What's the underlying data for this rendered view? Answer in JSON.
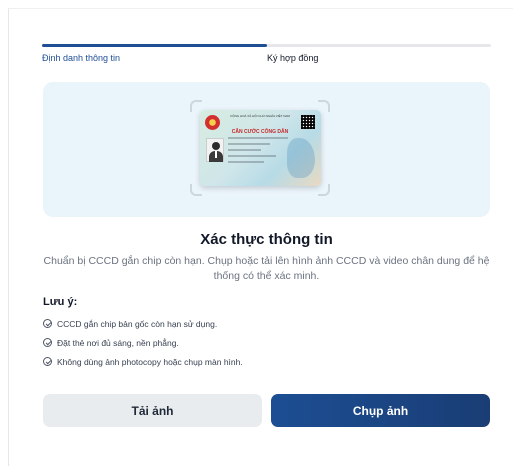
{
  "stepper": {
    "steps": [
      {
        "label": "Định danh thông tin",
        "active": true
      },
      {
        "label": "Ký hợp đồng",
        "active": false
      }
    ],
    "progress": 0.5
  },
  "id_card": {
    "header": "CỘNG HOÀ XÃ HỘI CHỦ NGHĨA VIỆT NAM",
    "heading": "CĂN CƯỚC CÔNG DÂN"
  },
  "content": {
    "title": "Xác thực thông tin",
    "description": "Chuẩn bị CCCD gắn chip còn hạn. Chụp hoặc tải lên hình ảnh CCCD và video chân dung để hệ thống có thể xác minh."
  },
  "notes": {
    "title": "Lưu ý:",
    "items": [
      "CCCD gắn chip bản gốc còn hạn sử dụng.",
      "Đặt thẻ nơi đủ sáng, nền phẳng.",
      "Không dùng ảnh photocopy hoặc chụp màn hình."
    ]
  },
  "actions": {
    "upload_label": "Tải ảnh",
    "capture_label": "Chụp ảnh"
  },
  "colors": {
    "primary": "#1e4f95",
    "panel": "#eaf4fb",
    "secondary_button": "#e9ecef"
  },
  "icons": {
    "note_bullet": "check-circle-icon",
    "card_emblem": "national-emblem-icon",
    "card_qr": "qr-code-icon"
  }
}
